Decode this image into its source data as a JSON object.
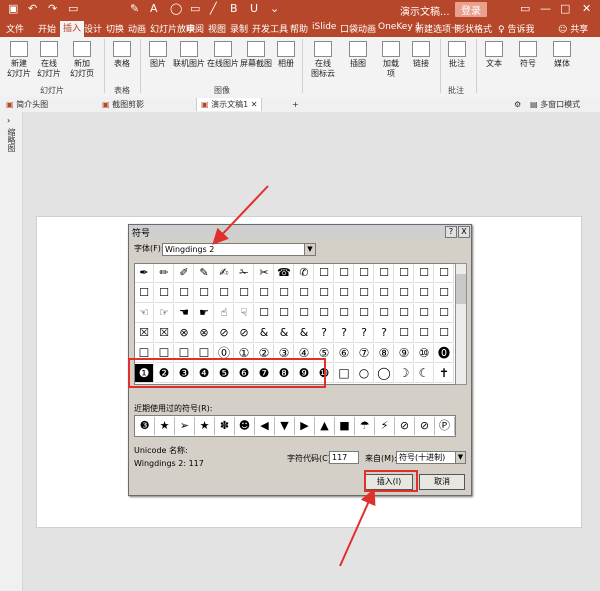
{
  "titlebar": {
    "doc_title": "演示文稿...",
    "login": "登录"
  },
  "tabs": [
    "文件",
    "开始",
    "插入",
    "设计",
    "切换",
    "动画",
    "幻灯片放映",
    "审阅",
    "视图",
    "录制",
    "开发工具",
    "帮助",
    "iSlide",
    "口袋动画",
    "OneKey 1",
    "新建选项卡",
    "形状格式",
    "告诉我",
    "共享"
  ],
  "ribbon": {
    "buttons": [
      "新建\n幻灯片",
      "在线\n幻灯片",
      "新加\n幻灯页",
      "表格",
      "图片",
      "联机图片",
      "在线图片",
      "屏幕截图",
      "相册",
      "在线\n图标云",
      "插图",
      "加载\n项",
      "链接",
      "批注",
      "文本",
      "符号",
      "媒体"
    ],
    "groups": [
      "幻灯片",
      "表格",
      "图像",
      "批注"
    ]
  },
  "doctabs": [
    "简介头图",
    "截图剪影",
    "演示文稿1"
  ],
  "doctabs_right": "多窗口模式",
  "sidepanel_label": "缩略图",
  "dialog": {
    "title": "符号",
    "help": "?",
    "close": "X",
    "font_label": "字体(F):",
    "font_value": "Wingdings 2",
    "grid_rows": [
      [
        "✒",
        "✏",
        "✐",
        "✎",
        "✍",
        "✁",
        "✂",
        "☎",
        "✆",
        "☐",
        "☐",
        "☐",
        "☐",
        "☐",
        "☐",
        "☐"
      ],
      [
        "☐",
        "☐",
        "☐",
        "☐",
        "☐",
        "☐",
        "☐",
        "☐",
        "☐",
        "☐",
        "☐",
        "☐",
        "☐",
        "☐",
        "☐",
        "☐"
      ],
      [
        "☜",
        "☞",
        "☚",
        "☛",
        "☝",
        "☟",
        "☐",
        "☐",
        "☐",
        "☐",
        "☐",
        "☐",
        "☐",
        "☐",
        "☐",
        "☐"
      ],
      [
        "☒",
        "☒",
        "⊗",
        "⊗",
        "⊘",
        "⊘",
        "&",
        "&",
        "&",
        "?",
        "?",
        "?",
        "?",
        "☐",
        "☐",
        "☐"
      ],
      [
        "☐",
        "☐",
        "☐",
        "☐",
        "⓪",
        "①",
        "②",
        "③",
        "④",
        "⑤",
        "⑥",
        "⑦",
        "⑧",
        "⑨",
        "⑩",
        "⓿"
      ],
      [
        "❶",
        "❷",
        "❸",
        "❹",
        "❺",
        "❻",
        "❼",
        "❽",
        "❾",
        "❿",
        "□",
        "○",
        "◯",
        "☽",
        "☾",
        "✝"
      ]
    ],
    "recent_label": "近期使用过的符号(R):",
    "recent": [
      "❸",
      "★",
      "➢",
      "★",
      "✽",
      "☻",
      "◀",
      "▼",
      "▶",
      "▲",
      "■",
      "☂",
      "⚡",
      "⊘",
      "⊘",
      "Ⓟ"
    ],
    "unicode_label": "Unicode 名称:",
    "unicode_value": "Wingdings 2: 117",
    "code_label": "字符代码(C):",
    "code_value": "117",
    "from_label": "来自(M):",
    "from_value": "符号(十进制)",
    "insert": "插入(I)",
    "cancel": "取消"
  }
}
